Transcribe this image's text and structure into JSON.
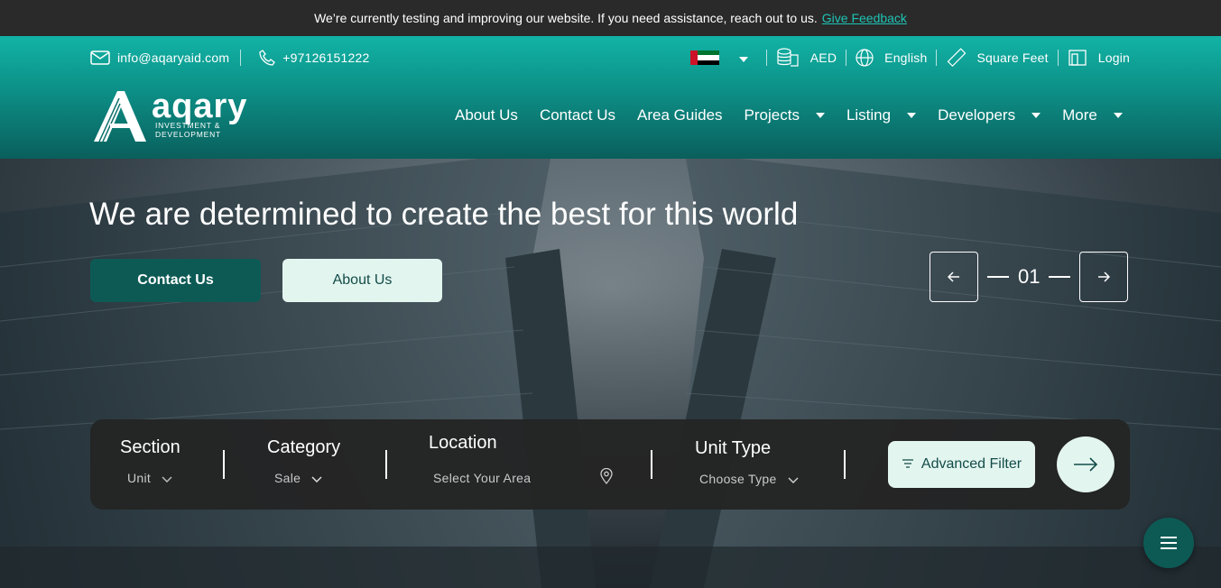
{
  "announcement": {
    "text": "We’re currently testing and improving our website. If you need assistance, reach out to us.",
    "link": "Give Feedback"
  },
  "topbar": {
    "email": "info@aqaryaid.com",
    "phone": "+97126151222",
    "currency": "AED",
    "language": "English",
    "unit": "Square Feet",
    "login": "Login"
  },
  "logo": {
    "brand": "aqary",
    "sub_line1": "INVESTMENT &",
    "sub_line2": "DEVELOPMENT"
  },
  "nav": {
    "about": "About Us",
    "contact": "Contact Us",
    "area_guides": "Area Guides",
    "projects": "Projects",
    "listing": "Listing",
    "developers": "Developers",
    "more": "More"
  },
  "hero": {
    "headline": "We are determined to create the best for this world",
    "contact_button": "Contact Us",
    "about_button": "About Us",
    "slide_number": "01"
  },
  "search": {
    "section_label": "Section",
    "section_value": "Unit",
    "category_label": "Category",
    "category_value": "Sale",
    "location_label": "Location",
    "location_placeholder": "Select Your Area",
    "unit_type_label": "Unit Type",
    "unit_type_value": "Choose Type",
    "advanced_filter": "Advanced Filter"
  },
  "colors": {
    "accent": "#12b3a6",
    "dark_teal": "#0d5a55",
    "mint": "#e3f5ef",
    "link": "#1fc3b4"
  },
  "icons": [
    "mail-icon",
    "phone-icon",
    "uae-flag-icon",
    "currency-icon",
    "globe-icon",
    "ruler-icon",
    "login-icon",
    "location-pin-icon",
    "filter-icon",
    "arrow-right-icon",
    "menu-icon"
  ]
}
